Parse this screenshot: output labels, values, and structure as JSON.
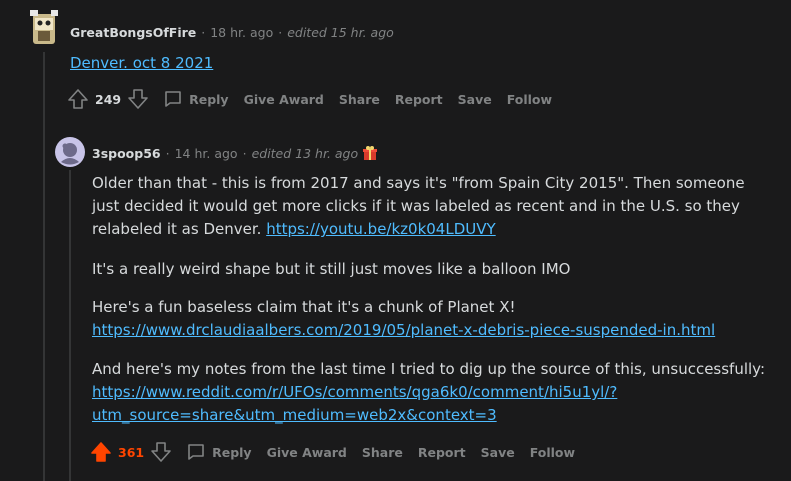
{
  "comment1": {
    "username": "GreatBongsOfFire",
    "time": "18 hr. ago",
    "edited": "edited 15 hr. ago",
    "link_text": "Denver. oct 8 2021",
    "score": "249",
    "actions": {
      "reply": "Reply",
      "give_award": "Give Award",
      "share": "Share",
      "report": "Report",
      "save": "Save",
      "follow": "Follow"
    }
  },
  "comment2": {
    "username": "3spoop56",
    "time": "14 hr. ago",
    "edited": "edited 13 hr. ago",
    "p1_text": "Older than that - this is from 2017 and says it's \"from Spain City 2015\". Then someone just decided it would get more clicks if it was labeled as recent and in the U.S. so they relabeled it as Denver.",
    "p1_link": "https://youtu.be/kz0k04LDUVY",
    "p2_text": "It's a really weird shape but it still just moves like a balloon IMO",
    "p3_text": "Here's a fun baseless claim that it's a chunk of Planet X!",
    "p3_link": "https://www.drclaudiaalbers.com/2019/05/planet-x-debris-piece-suspended-in.html",
    "p4_text": "And here's my notes from the last time I tried to dig up the source of this, unsuccessfully:",
    "p4_link_line1": "https://www.reddit.com/r/UFOs/comments/qga6k0/comment/hi5u1yl/?",
    "p4_link_line2": "utm_source=share&utm_medium=web2x&context=3",
    "score": "361",
    "actions": {
      "reply": "Reply",
      "give_award": "Give Award",
      "share": "Share",
      "report": "Report",
      "save": "Save",
      "follow": "Follow"
    }
  },
  "colors": {
    "background": "#1a1a1b",
    "link": "#4fbcff",
    "upvote": "#ff4500",
    "muted": "#818384",
    "text": "#d7dadc"
  }
}
